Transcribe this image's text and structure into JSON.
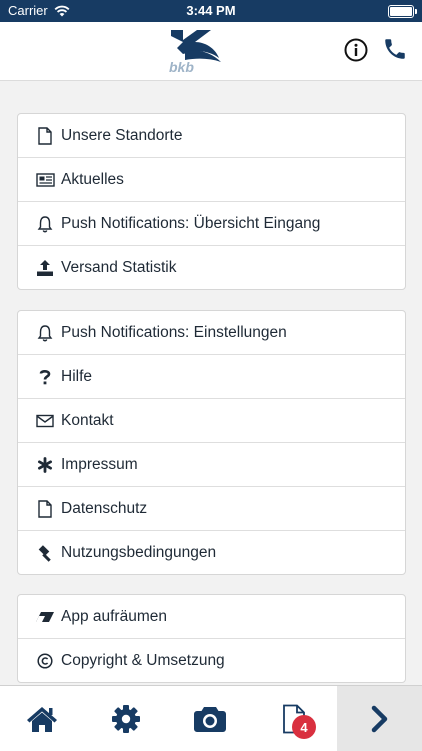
{
  "status": {
    "carrier": "Carrier",
    "time": "3:44 PM"
  },
  "header": {
    "logo_text": "bkb"
  },
  "groups": [
    [
      {
        "label": "Unsere Standorte",
        "icon": "file-icon"
      },
      {
        "label": "Aktuelles",
        "icon": "newspaper-icon"
      },
      {
        "label": "Push Notifications: Übersicht Eingang",
        "icon": "bell-icon"
      },
      {
        "label": "Versand Statistik",
        "icon": "upload-icon"
      }
    ],
    [
      {
        "label": "Push Notifications: Einstellungen",
        "icon": "bell-icon"
      },
      {
        "label": "Hilfe",
        "icon": "question-icon"
      },
      {
        "label": "Kontakt",
        "icon": "envelope-icon"
      },
      {
        "label": "Impressum",
        "icon": "asterisk-icon"
      },
      {
        "label": "Datenschutz",
        "icon": "file-icon"
      },
      {
        "label": "Nutzungsbedingungen",
        "icon": "gavel-icon"
      }
    ],
    [
      {
        "label": "App aufräumen",
        "icon": "eraser-icon"
      },
      {
        "label": "Copyright & Umsetzung",
        "icon": "copyright-icon"
      }
    ]
  ],
  "tabbar": {
    "items": [
      "home-icon",
      "gear-icon",
      "camera-icon",
      "document-icon",
      "chevron-right-icon"
    ],
    "badge_count": "4"
  },
  "colors": {
    "brand": "#173b63",
    "badge": "#d9303f"
  }
}
